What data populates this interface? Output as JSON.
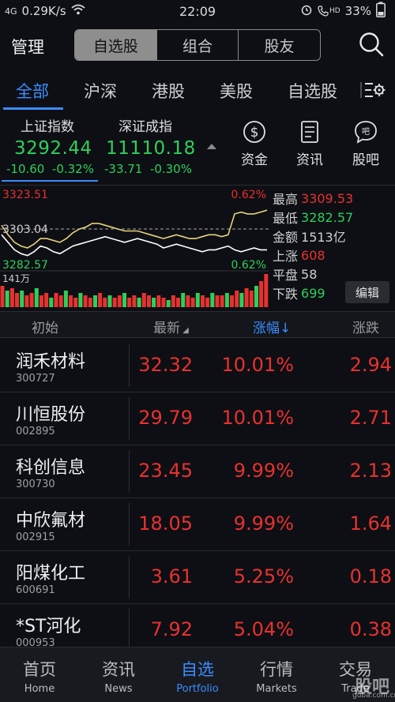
{
  "status_bar": {
    "signal": "4G",
    "speed": "0.29K/s",
    "time": "22:09",
    "battery": "33%",
    "hd": "HD"
  },
  "header": {
    "title": "管理",
    "segments": [
      "自选股",
      "组合",
      "股友"
    ],
    "active_segment": 0
  },
  "market_tabs": {
    "items": [
      "全部",
      "沪深",
      "港股",
      "美股",
      "自选股"
    ],
    "active": 0
  },
  "indices": [
    {
      "name": "上证指数",
      "price": "3292.44",
      "change": "-10.60",
      "percent": "-0.32%"
    },
    {
      "name": "深证成指",
      "price": "11110.18",
      "change": "-33.71",
      "percent": "-0.30%"
    }
  ],
  "quick_links": [
    {
      "label": "资金",
      "icon": "dollar-circle-icon"
    },
    {
      "label": "资讯",
      "icon": "document-icon"
    },
    {
      "label": "股吧",
      "icon": "chat-bubble-icon"
    }
  ],
  "chart_data": {
    "type": "line",
    "y_top_label": "3323.51",
    "y_mid_label": "3303.04",
    "y_bottom_label": "3282.57",
    "pct_top_label": "0.62%",
    "pct_bottom_label": "0.62%",
    "volume_label": "141万",
    "ylim": [
      3282.57,
      3323.51
    ],
    "prev_close": 3303.04,
    "series": [
      {
        "values": [
          3300,
          3296,
          3292,
          3290,
          3289,
          3291,
          3294,
          3293,
          3291,
          3290,
          3292,
          3294,
          3295,
          3296,
          3297,
          3298,
          3299,
          3298,
          3297,
          3296,
          3297,
          3298,
          3297,
          3296,
          3295,
          3293,
          3294,
          3295,
          3294,
          3293,
          3292,
          3291,
          3292,
          3292,
          3293,
          3294,
          3292,
          3291,
          3292,
          3293,
          3292,
          3292
        ]
      },
      {
        "values": [
          3305,
          3300,
          3296,
          3294,
          3293,
          3295,
          3298,
          3298,
          3297,
          3296,
          3298,
          3301,
          3303,
          3304,
          3306,
          3306,
          3305,
          3304,
          3303,
          3302,
          3302,
          3302,
          3301,
          3300,
          3299,
          3298,
          3299,
          3300,
          3299,
          3298,
          3298,
          3299,
          3300,
          3300,
          3299,
          3300,
          3311,
          3312,
          3311,
          3311,
          3312,
          3313
        ]
      }
    ],
    "volume": [
      9,
      7,
      8,
      6,
      7,
      5,
      6,
      8,
      5,
      6,
      4,
      6,
      5,
      7,
      5,
      4,
      6,
      5,
      4,
      5,
      6,
      4,
      5,
      4,
      5,
      6,
      4,
      5,
      4,
      6,
      5,
      4,
      5,
      4,
      3,
      5,
      4,
      6,
      5,
      4,
      6,
      5,
      4,
      6,
      5,
      5,
      6,
      5,
      7,
      6,
      8,
      7,
      9,
      11,
      14
    ]
  },
  "stats": [
    {
      "label": "最高",
      "value": "3309.53",
      "color": "up"
    },
    {
      "label": "最低",
      "value": "3282.57",
      "color": "down"
    },
    {
      "label": "金额",
      "value": "1513亿",
      "color": "neutral"
    },
    {
      "label": "上涨",
      "value": "608",
      "color": "up"
    },
    {
      "label": "平盘",
      "value": "58",
      "color": "neutral"
    },
    {
      "label": "下跌",
      "value": "699",
      "color": "down"
    }
  ],
  "edit_label": "编辑",
  "list_header": {
    "col1": "初始",
    "col2": "最新",
    "col3": "涨幅",
    "col4": "涨跌"
  },
  "stocks": [
    {
      "name": "润禾材料",
      "code": "300727",
      "price": "32.32",
      "pct": "10.01%",
      "chg": "2.94"
    },
    {
      "name": "川恒股份",
      "code": "002895",
      "price": "29.79",
      "pct": "10.01%",
      "chg": "2.71"
    },
    {
      "name": "科创信息",
      "code": "300730",
      "price": "23.45",
      "pct": "9.99%",
      "chg": "2.13"
    },
    {
      "name": "中欣氟材",
      "code": "002915",
      "price": "18.05",
      "pct": "9.99%",
      "chg": "1.64"
    },
    {
      "name": "阳煤化工",
      "code": "600691",
      "price": "3.61",
      "pct": "5.25%",
      "chg": "0.18"
    },
    {
      "name": "*ST河化",
      "code": "000953",
      "price": "7.92",
      "pct": "5.04%",
      "chg": "0.38"
    }
  ],
  "bottom_nav": [
    {
      "cn": "首页",
      "en": "Home"
    },
    {
      "cn": "资讯",
      "en": "News"
    },
    {
      "cn": "自选",
      "en": "Portfolio"
    },
    {
      "cn": "行情",
      "en": "Markets"
    },
    {
      "cn": "交易",
      "en": "Trade"
    }
  ],
  "bottom_nav_active": 2,
  "watermark": "股吧",
  "watermark_sub": "guba.com.cn",
  "colors": {
    "up": "#e8312f",
    "down": "#2fcf5a",
    "accent": "#3a8dff"
  }
}
